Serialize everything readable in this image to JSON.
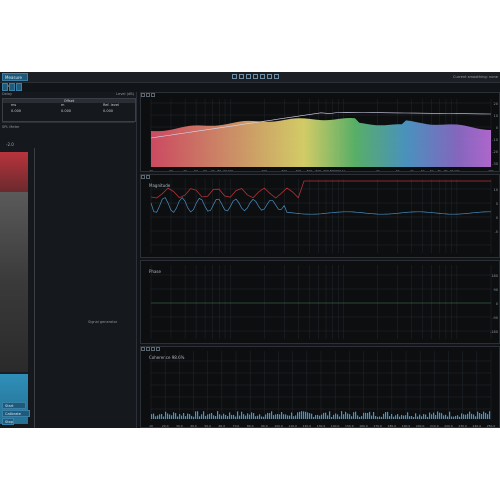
{
  "toolbar": {
    "measure_button": "Measure input",
    "right_status": "Current smoothing: none"
  },
  "left_panel": {
    "header_left": "Delay",
    "header_right": "Level (dB)",
    "table_header": "Offset",
    "col1": "ms",
    "col2": "m",
    "col3": "Ref. level",
    "val1": "0.000",
    "val2": "0.000",
    "val3": "0.000",
    "meter_top": "-2.0",
    "lbl_spl": "SPL Meter",
    "btn_bottom1": "Start",
    "btn_bottom2": "Calibrate",
    "btn_bottom3": "Stop",
    "status_text": "Signal generator"
  },
  "plots": {
    "magnitude_title": "Magnitude",
    "phase_title": "Phase",
    "coherence_title": "Coherence 98.6%"
  },
  "chart_data": [
    {
      "type": "area",
      "x_scale": "log",
      "x_ticks": [
        "20",
        "30",
        "40",
        "50",
        "60",
        "70",
        "80",
        "90",
        "100",
        "200",
        "300",
        "400",
        "500",
        "600",
        "700",
        "800",
        "900",
        "1k",
        "2k",
        "3k",
        "4k",
        "5k",
        "6k",
        "7k",
        "8k",
        "9k",
        "10k",
        "20k"
      ],
      "y_ticks": [
        "20",
        "10",
        "0",
        "-10",
        "-20",
        "-30"
      ]
    },
    {
      "type": "line",
      "x_scale": "log",
      "y_ticks": [
        "10",
        "5",
        "0",
        "-5"
      ]
    },
    {
      "type": "line",
      "x_scale": "log",
      "y_ticks": [
        "180",
        "90",
        "0",
        "-90",
        "-180"
      ]
    },
    {
      "type": "bar",
      "x_ticks": [
        "10",
        "20.0",
        "30.0",
        "40.0",
        "50.0",
        "60.0",
        "70.0",
        "80.0",
        "90.0",
        "100.0",
        "110.0",
        "120.0",
        "130.0",
        "140.0",
        "150.0",
        "160.0",
        "170.0",
        "180.0",
        "190.0",
        "200.0",
        "210.0",
        "220.0",
        "230.0",
        "240.0",
        "250.0"
      ]
    }
  ]
}
